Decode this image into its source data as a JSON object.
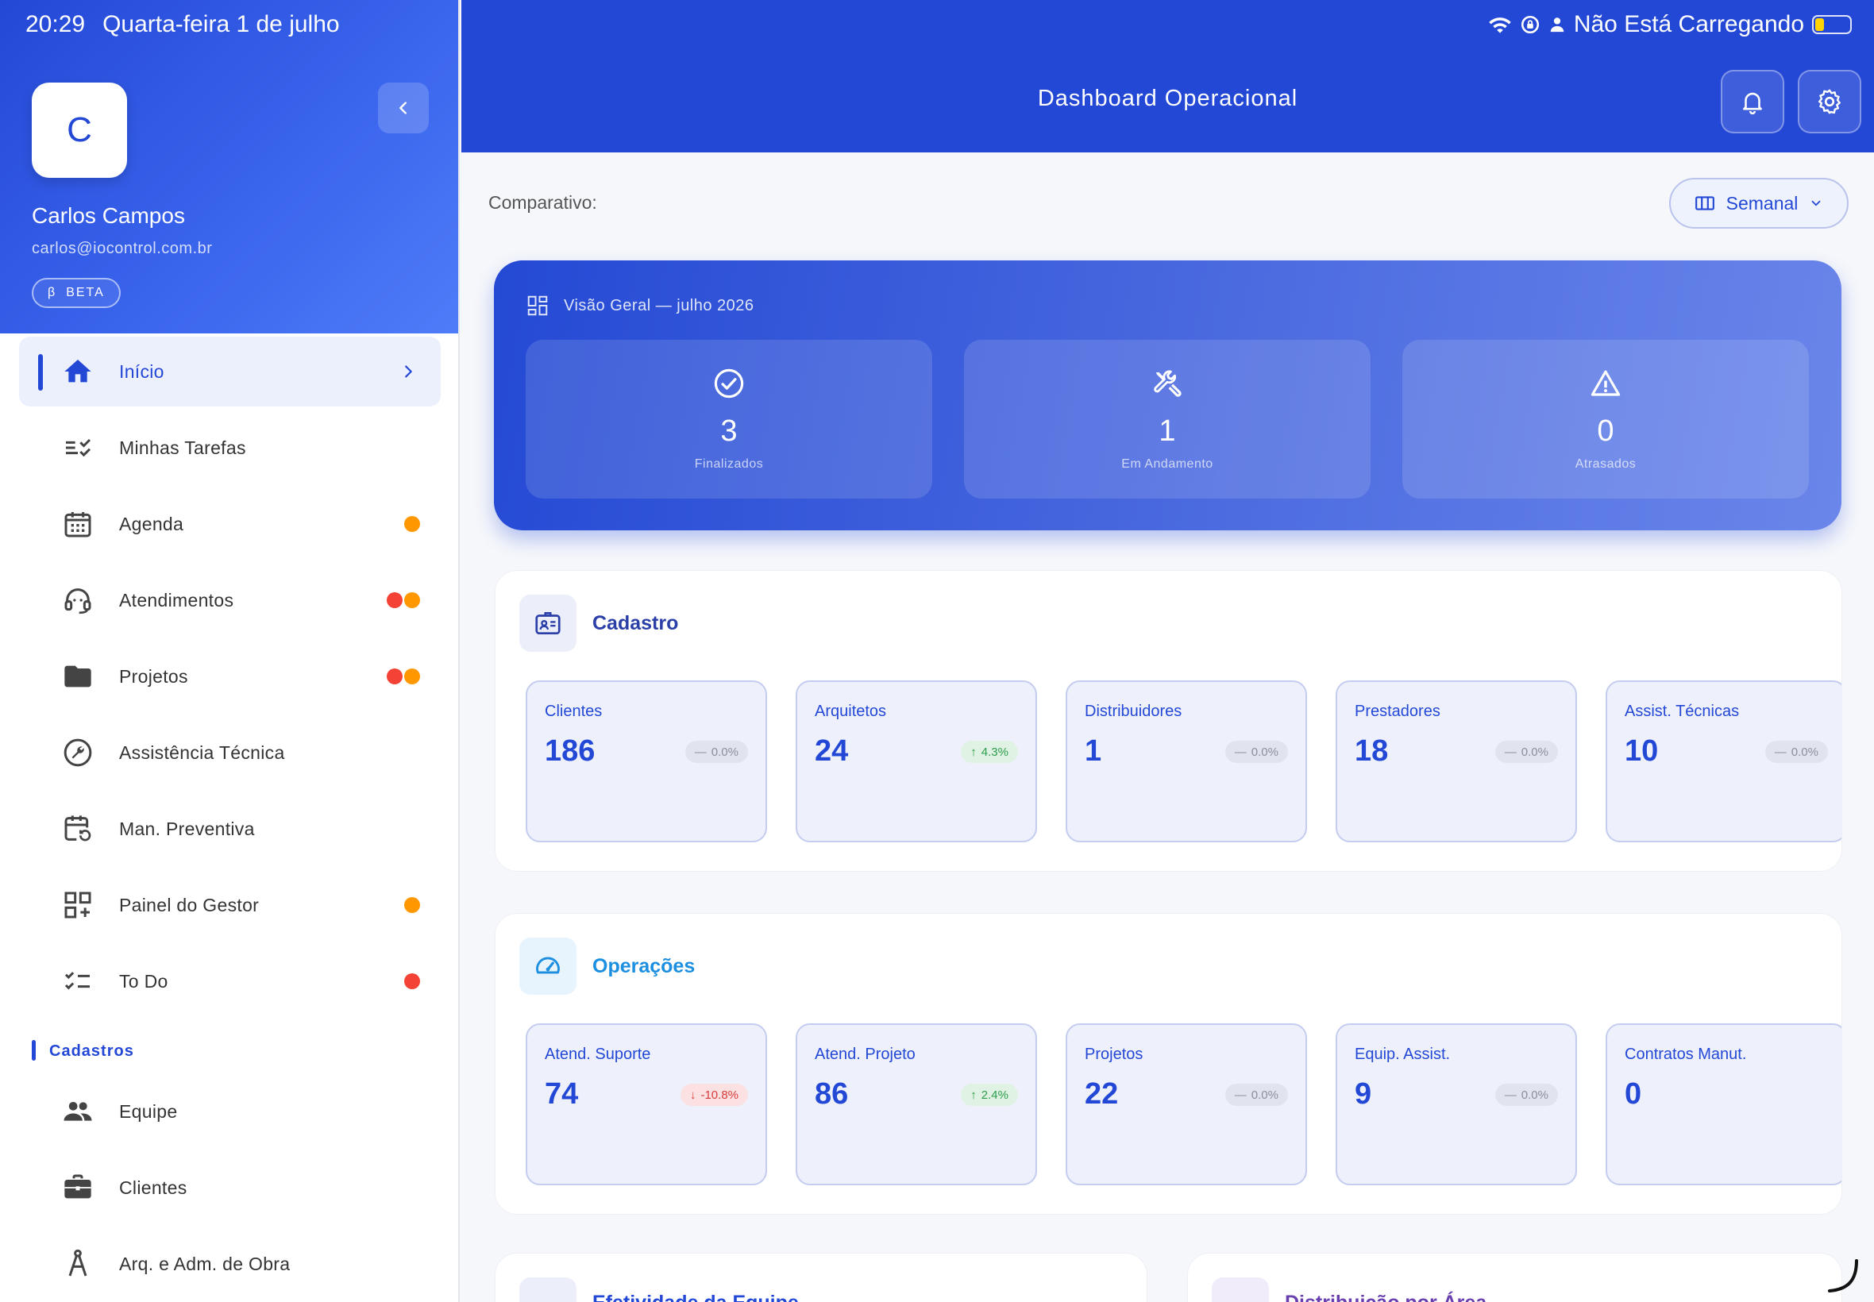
{
  "status_bar": {
    "time": "20:29",
    "date": "Quarta-feira 1 de julho",
    "charging_text": "Não Está Carregando",
    "battery_level": 0.25
  },
  "sidebar": {
    "avatar_initial": "C",
    "user_name": "Carlos Campos",
    "user_email": "carlos@iocontrol.com.br",
    "badge_symbol": "β",
    "badge_label": "BETA",
    "items": [
      {
        "label": "Início",
        "icon": "home-icon",
        "active": true
      },
      {
        "label": "Minhas Tarefas",
        "icon": "tasks-icon",
        "dots": []
      },
      {
        "label": "Agenda",
        "icon": "calendar-icon",
        "dots": [
          "orange"
        ]
      },
      {
        "label": "Atendimentos",
        "icon": "support-agent-icon",
        "dots": [
          "red",
          "orange"
        ]
      },
      {
        "label": "Projetos",
        "icon": "folder-icon",
        "dots": [
          "red",
          "orange"
        ]
      },
      {
        "label": "Assistência Técnica",
        "icon": "wrench-icon",
        "dots": []
      },
      {
        "label": "Man. Preventiva",
        "icon": "calendar-repeat-icon",
        "dots": []
      },
      {
        "label": "Painel do Gestor",
        "icon": "dashboard-add-icon",
        "dots": [
          "orange"
        ]
      },
      {
        "label": "To Do",
        "icon": "checklist-icon",
        "dots": [
          "red"
        ]
      }
    ],
    "section_cadastros": "Cadastros",
    "cadastros_items": [
      {
        "label": "Equipe",
        "icon": "people-icon"
      },
      {
        "label": "Clientes",
        "icon": "briefcase-icon"
      },
      {
        "label": "Arq. e Adm. de Obra",
        "icon": "compass-icon"
      }
    ]
  },
  "header": {
    "title": "Dashboard Operacional"
  },
  "toolbar": {
    "comparativo_label": "Comparativo:",
    "period_label": "Semanal"
  },
  "overview": {
    "title": "Visão Geral — julho 2026",
    "cards": [
      {
        "value": "3",
        "label": "Finalizados",
        "icon": "check-circle-icon"
      },
      {
        "value": "1",
        "label": "Em Andamento",
        "icon": "tools-icon"
      },
      {
        "value": "0",
        "label": "Atrasados",
        "icon": "warning-icon"
      }
    ]
  },
  "cadastro": {
    "title": "Cadastro",
    "color": "#2b3fa8",
    "stats": [
      {
        "label": "Clientes",
        "value": "186",
        "trend": "0.0%",
        "dir": "neutral"
      },
      {
        "label": "Arquitetos",
        "value": "24",
        "trend": "4.3%",
        "dir": "up"
      },
      {
        "label": "Distribuidores",
        "value": "1",
        "trend": "0.0%",
        "dir": "neutral"
      },
      {
        "label": "Prestadores",
        "value": "18",
        "trend": "0.0%",
        "dir": "neutral"
      },
      {
        "label": "Assist. Técnicas",
        "value": "10",
        "trend": "0.0%",
        "dir": "neutral"
      }
    ]
  },
  "operacoes": {
    "title": "Operações",
    "color": "#1d8fe0",
    "stats": [
      {
        "label": "Atend. Suporte",
        "value": "74",
        "trend": "-10.8%",
        "dir": "down"
      },
      {
        "label": "Atend. Projeto",
        "value": "86",
        "trend": "2.4%",
        "dir": "up"
      },
      {
        "label": "Projetos",
        "value": "22",
        "trend": "0.0%",
        "dir": "neutral"
      },
      {
        "label": "Equip. Assist.",
        "value": "9",
        "trend": "0.0%",
        "dir": "neutral"
      },
      {
        "label": "Contratos Manut.",
        "value": "0",
        "trend": "",
        "dir": "none"
      }
    ]
  },
  "bottom_sections": [
    {
      "title": "Efetividade da Equipe"
    },
    {
      "title": "Distribuição por Área"
    }
  ]
}
